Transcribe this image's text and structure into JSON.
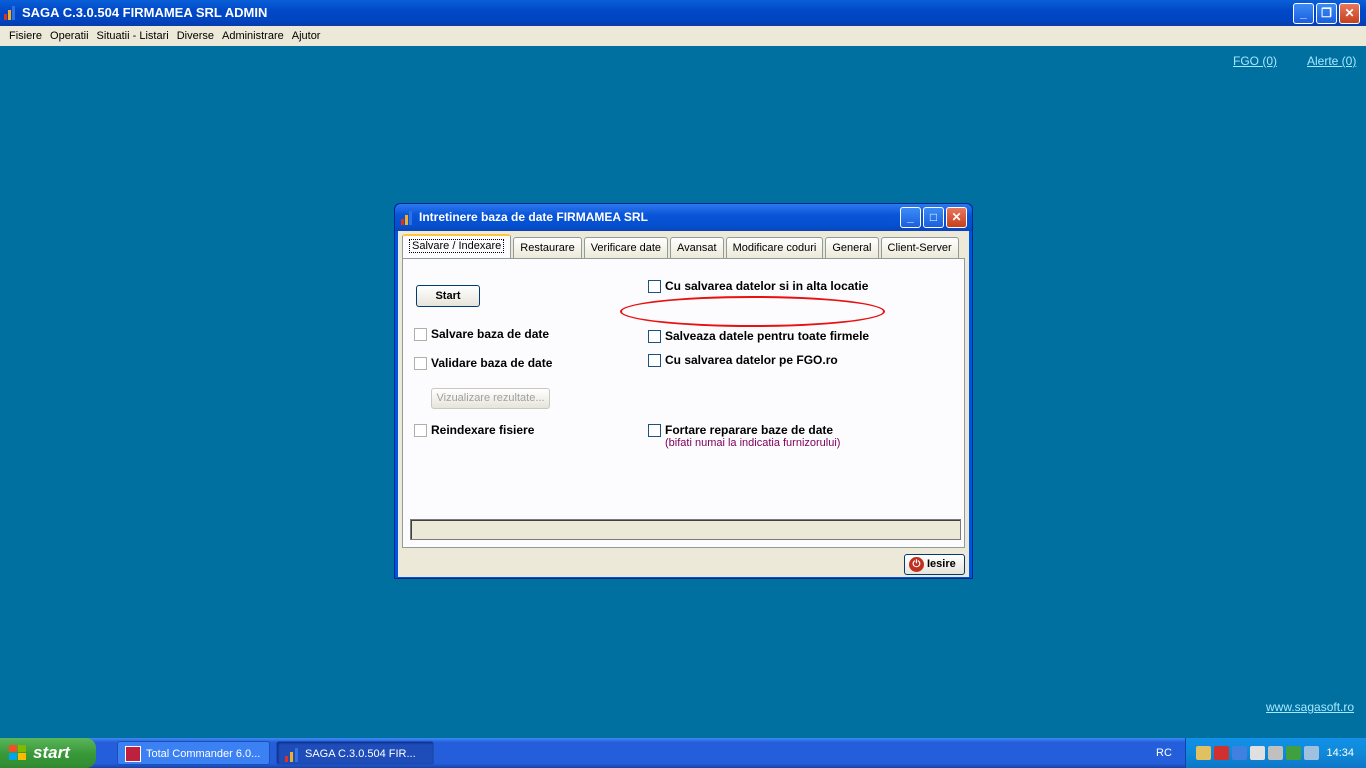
{
  "app": {
    "title": "SAGA C.3.0.504  FIRMAMEA SRL  ADMIN",
    "menu": [
      "Fisiere",
      "Operatii",
      "Situatii - Listari",
      "Diverse",
      "Administrare",
      "Ajutor"
    ],
    "links": {
      "fgo": "FGO (0)",
      "alerte": "Alerte (0)",
      "site": "www.sagasoft.ro"
    }
  },
  "dialog": {
    "title": "Intretinere baza de date FIRMAMEA SRL",
    "tabs": [
      "Salvare / Indexare",
      "Restaurare",
      "Verificare date",
      "Avansat",
      "Modificare coduri",
      "General",
      "Client-Server"
    ],
    "active_tab": "Salvare / Indexare",
    "start_label": "Start",
    "checkboxes_left": [
      {
        "label": "Salvare baza de date",
        "checked": false
      },
      {
        "label": "Validare baza de date",
        "checked": false
      },
      {
        "label": "Reindexare fisiere",
        "checked": false
      }
    ],
    "view_results_label": "Vizualizare rezultate...",
    "checkboxes_right": [
      {
        "label": "Cu salvarea datelor si in alta locatie",
        "checked": false
      },
      {
        "label": "Salveaza datele pentru toate firmele",
        "checked": false
      },
      {
        "label": "Cu salvarea datelor pe FGO.ro",
        "checked": false
      },
      {
        "label": "Fortare reparare baze de date",
        "sub": "(bifati numai la indicatia furnizorului)",
        "checked": false
      }
    ],
    "exit_label": "Iesire"
  },
  "taskbar": {
    "start_label": "start",
    "tasks": [
      "Total Commander 6.0...",
      "SAGA C.3.0.504  FIR..."
    ],
    "lang": "RC",
    "clock": "14:34"
  },
  "colors": {
    "desktop": "#0070a0",
    "highlight": "#e81010",
    "titlebar": "#0054e3"
  }
}
